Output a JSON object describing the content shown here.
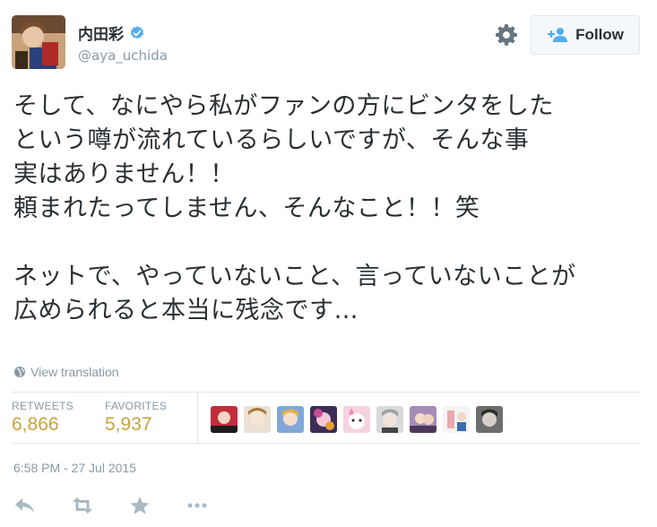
{
  "header": {
    "display_name": "内田彩",
    "handle": "@aya_uchida",
    "follow_label": "Follow"
  },
  "tweet": {
    "text": "そして、なにやら私がファンの方にビンタをした\nという噂が流れているらしいですが、そんな事\n実はありません！！\n頼まれたってしません、そんなこと！！笑\n\nネットで、やっていないこと、言っていないことが\n広められると本当に残念です…",
    "translate_label": "View translation",
    "timestamp": "6:58 PM - 27 Jul 2015"
  },
  "stats": {
    "retweets_label": "RETWEETS",
    "retweets_value": "6,866",
    "favorites_label": "FAVORITES",
    "favorites_value": "5,937"
  },
  "icons": {
    "verified": "verified-badge-icon",
    "gear": "gear-icon",
    "follow": "add-user-icon",
    "translate": "globe-icon",
    "reply": "reply-icon",
    "retweet": "retweet-icon",
    "favorite": "star-icon",
    "more": "more-dots-icon"
  },
  "colors": {
    "verified_blue": "#55acee",
    "stat_value": "#c8a33a",
    "muted": "#8899a6"
  }
}
